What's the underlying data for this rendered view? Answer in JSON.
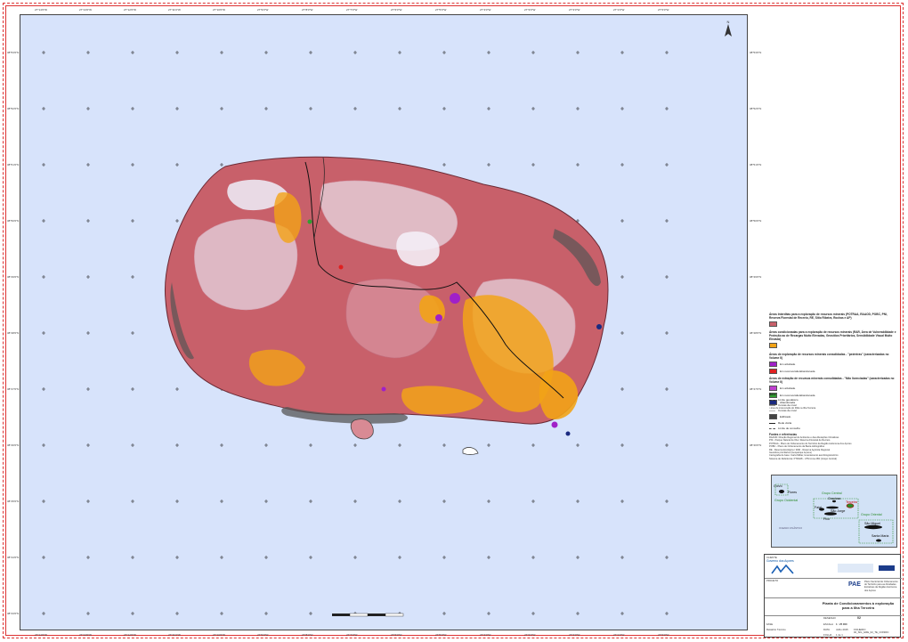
{
  "coords": {
    "top": [
      "27°14'0\"W",
      "27°13'0\"W",
      "27°12'0\"W",
      "27°11'0\"W",
      "27°10'0\"W",
      "27°9'0\"W",
      "27°8'0\"W",
      "27°7'0\"W",
      "27°6'0\"W",
      "27°5'0\"W",
      "27°4'0\"W",
      "27°3'0\"W",
      "27°2'0\"W",
      "27°1'0\"W",
      "27°0'0\"W"
    ],
    "bottom": [
      "27°14'0\"W",
      "27°13'0\"W",
      "27°12'0\"W",
      "27°11'0\"W",
      "27°10'0\"W",
      "27°9'0\"W",
      "27°8'0\"W",
      "27°7'0\"W",
      "27°6'0\"W",
      "27°5'0\"W",
      "27°4'0\"W",
      "27°3'0\"W",
      "27°2'0\"W",
      "27°1'0\"W",
      "27°0'0\"W"
    ],
    "left": [
      "38°53'0\"N",
      "38°52'0\"N",
      "38°51'0\"N",
      "38°50'0\"N",
      "38°49'0\"N",
      "38°48'0\"N",
      "38°47'0\"N",
      "38°46'0\"N",
      "38°45'0\"N",
      "38°44'0\"N",
      "38°43'0\"N"
    ],
    "right": [
      "38°53'0\"N",
      "38°52'0\"N",
      "38°51'0\"N",
      "38°50'0\"N",
      "38°49'0\"N",
      "38°48'0\"N",
      "38°47'0\"N",
      "38°46'0\"N",
      "38°45'0\"N",
      "38°44'0\"N",
      "38°43'0\"N"
    ]
  },
  "legend": {
    "section1_title": "Áreas Interditas para a exploração de recursos minerais (POTRAA, RAAOD, POBC, PNI, Reserva Florestal de Recreio, RE, Sitio Ribeira, Rochas e AP)",
    "section2_title": "Áreas condicionadas para a exploração de recursos minerais (RAR, Área de Vulnerabilidade e Proteção ao de Recargas Muito Elevadas, Geosítios Prioritários, Sensibilidade Visual Muito Elevada)",
    "section3_title": "Áreas de exploração de recursos minerais consolidadas - \"pedreiras\" (caracterizadas no Volume II)",
    "section3_items": [
      {
        "label": "Em atividade",
        "color": "#a020c8"
      },
      {
        "label": "Em reconversão/abandonada",
        "color": "#e02020"
      }
    ],
    "section4_title": "Áreas de extração de recursos minerais consolidadas - \"Não licenciadas\" (caracterizadas no Volume II)",
    "section4_items": [
      {
        "label": "Em atividade",
        "color": "#c040d0"
      },
      {
        "label": "Em reconversão/abandonada",
        "color": "#30a030"
      },
      {
        "label": "Abandonada",
        "color": "#1a2a80"
      }
    ],
    "footnote": "¹ área de intervenção do PAE na Ilha Terceira",
    "base_title": "Base",
    "base_items": [
      {
        "label": "Limite geodésico",
        "color": "#333333"
      },
      {
        "label": "Curvas de nível",
        "color": "#999999"
      },
      {
        "label": "Curvas de nível",
        "color": "#bbbbbb"
      },
      {
        "label": "Edificado",
        "color": "#444444"
      },
      {
        "label": "Rede viária",
        "color": "#222222"
      },
      {
        "label": "Limite de concelho",
        "color": "#555555"
      }
    ],
    "notes_title": "Fontes e referências",
    "notes": [
      "RAAOD: Direção Regional do Ambiente e das Alterações Climáticas",
      "PNI - Parque Natural de Ilha / Reserva Florestal de Recreio",
      "POTRAA - Plano de Ordenamento do Território da Região Autónoma dos Açores",
      "POBC - Plano de Ordenamento da Bacia Hidrográfica",
      "RE - Reserva Ecológica / RAR - Reserva Agrícola Regional",
      "Geosítios prioritários (Geoparque Açores)",
      "Cartografia de base: Carta Militar, levantamento aerofotogramétrico",
      "Sistema de Referência: PTRA08 - UTM zona 26N (Grupo Central)"
    ]
  },
  "inset": {
    "labels": {
      "corvo": "Corvo",
      "flores": "Flores",
      "grupo_ocidental": "Grupo Ocidental",
      "grupo_central": "Grupo Central",
      "graciosa": "Graciosa",
      "terceira": "Terceira",
      "sao_jorge": "São Jorge",
      "faial": "Faial",
      "pico": "Pico",
      "grupo_oriental": "Grupo Oriental",
      "sao_miguel": "São Miguel",
      "santa_maria": "Santa Maria",
      "ocean": "OCEANO ATLÂNTICO"
    }
  },
  "title_block": {
    "logo_text": "PAE",
    "title": "Planta de Condicionamentos à exploração para a Ilha Terceira",
    "client_label": "CLIENTE",
    "client": "Governo dos Açores",
    "project_label": "PROJETO",
    "project": "Plano Sectorial de Ordenamento do Território para as Atividades Extrativas da Região Autónoma dos Açores",
    "scale_label": "ESCALA",
    "scale": "1 : 25 000",
    "date_label": "DATA",
    "date": "Julho 2015",
    "drawing_label": "DESENHO",
    "drawing": "02",
    "sheet_label": "FOLHA",
    "sheet": "1 de 1",
    "file_label": "FICHEIRO",
    "file": "02_SIG_GRE_02_TE_CONDIC",
    "phase_label": "FASE",
    "phase": "Relatório Técnico"
  },
  "colors": {
    "sea": "#d7e3fb",
    "interdita": "#c8606a",
    "condicionada": "#f2a317",
    "contours": "#e8d8e0",
    "builtup": "#444444"
  }
}
